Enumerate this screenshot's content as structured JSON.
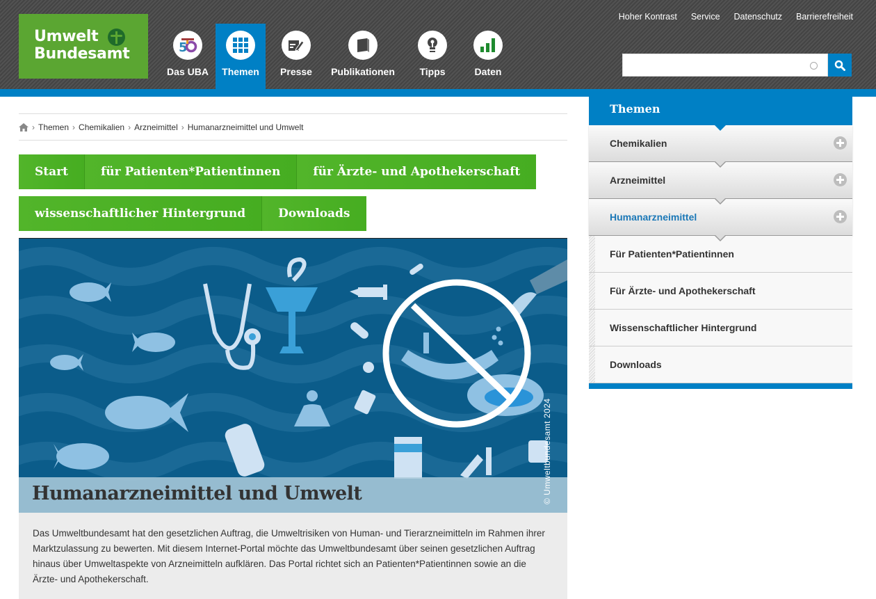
{
  "header": {
    "logo_line1": "Umwelt",
    "logo_line2": "Bundesamt",
    "nav": [
      {
        "label": "Das UBA",
        "icon": "uba-50-icon"
      },
      {
        "label": "Themen",
        "icon": "grid-icon",
        "active": true
      },
      {
        "label": "Presse",
        "icon": "notepad-pen-icon"
      },
      {
        "label": "Publikationen",
        "icon": "book-icon"
      },
      {
        "label": "Tipps",
        "icon": "lightbulb-icon"
      },
      {
        "label": "Daten",
        "icon": "bar-chart-icon"
      }
    ],
    "toplinks": [
      "Hoher Kontrast",
      "Service",
      "Datenschutz",
      "Barrierefreiheit"
    ],
    "search": {
      "value": "",
      "placeholder": ""
    },
    "colors": {
      "brand_green": "#5ba632",
      "accent_blue": "#0080c5"
    }
  },
  "breadcrumb": {
    "home_icon": "home-icon",
    "items": [
      "Themen",
      "Chemikalien",
      "Arzneimittel",
      "Humanarzneimittel und Umwelt"
    ],
    "separator": "›"
  },
  "tabs": {
    "row1": [
      "Start",
      "für Patienten*Patientinnen",
      "für Ärzte- und Apothekerschaft"
    ],
    "row2": [
      "wissenschaftlicher Hintergrund",
      "Downloads"
    ]
  },
  "hero": {
    "title": "Humanarzneimittel und Umwelt",
    "copyright": "© Umweltbundesamt 2024",
    "illustration": "fish, stethoscope, caduceus, pills, crossed-out sink and toilet"
  },
  "description": "Das Umweltbundesamt hat den gesetzlichen Auftrag, die Umweltrisiken von Human- und Tierarzneimitteln im Rahmen ihrer Marktzulassung zu bewerten. Mit diesem Internet-Portal möchte das Umweltbundesamt über seinen gesetzlichen Auftrag hinaus über Umweltaspekte von Arzneimitteln aufklären. Das Portal richtet sich an Patienten*Patientinnen sowie an die Ärzte- und Apothekerschaft.",
  "sidebar": {
    "title": "Themen",
    "items": [
      {
        "label": "Chemikalien",
        "expand": true
      },
      {
        "label": "Arzneimittel",
        "expand": true
      },
      {
        "label": "Humanarzneimittel",
        "expand": true,
        "active": true
      }
    ],
    "subitems": [
      "Für Patienten*Patientinnen",
      "Für Ärzte- und Apothekerschaft",
      "Wissenschaftlicher Hintergrund",
      "Downloads"
    ]
  }
}
